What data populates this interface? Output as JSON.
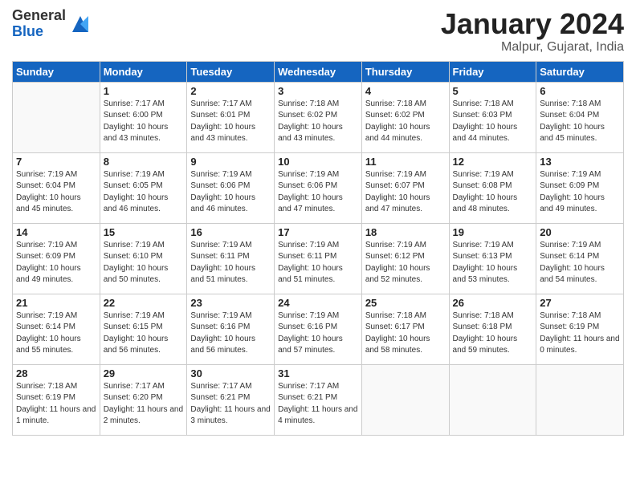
{
  "header": {
    "logo_general": "General",
    "logo_blue": "Blue",
    "title": "January 2024",
    "location": "Malpur, Gujarat, India"
  },
  "weekdays": [
    "Sunday",
    "Monday",
    "Tuesday",
    "Wednesday",
    "Thursday",
    "Friday",
    "Saturday"
  ],
  "weeks": [
    [
      {
        "day": "",
        "sunrise": "",
        "sunset": "",
        "daylight": ""
      },
      {
        "day": "1",
        "sunrise": "Sunrise: 7:17 AM",
        "sunset": "Sunset: 6:00 PM",
        "daylight": "Daylight: 10 hours and 43 minutes."
      },
      {
        "day": "2",
        "sunrise": "Sunrise: 7:17 AM",
        "sunset": "Sunset: 6:01 PM",
        "daylight": "Daylight: 10 hours and 43 minutes."
      },
      {
        "day": "3",
        "sunrise": "Sunrise: 7:18 AM",
        "sunset": "Sunset: 6:02 PM",
        "daylight": "Daylight: 10 hours and 43 minutes."
      },
      {
        "day": "4",
        "sunrise": "Sunrise: 7:18 AM",
        "sunset": "Sunset: 6:02 PM",
        "daylight": "Daylight: 10 hours and 44 minutes."
      },
      {
        "day": "5",
        "sunrise": "Sunrise: 7:18 AM",
        "sunset": "Sunset: 6:03 PM",
        "daylight": "Daylight: 10 hours and 44 minutes."
      },
      {
        "day": "6",
        "sunrise": "Sunrise: 7:18 AM",
        "sunset": "Sunset: 6:04 PM",
        "daylight": "Daylight: 10 hours and 45 minutes."
      }
    ],
    [
      {
        "day": "7",
        "sunrise": "Sunrise: 7:19 AM",
        "sunset": "Sunset: 6:04 PM",
        "daylight": "Daylight: 10 hours and 45 minutes."
      },
      {
        "day": "8",
        "sunrise": "Sunrise: 7:19 AM",
        "sunset": "Sunset: 6:05 PM",
        "daylight": "Daylight: 10 hours and 46 minutes."
      },
      {
        "day": "9",
        "sunrise": "Sunrise: 7:19 AM",
        "sunset": "Sunset: 6:06 PM",
        "daylight": "Daylight: 10 hours and 46 minutes."
      },
      {
        "day": "10",
        "sunrise": "Sunrise: 7:19 AM",
        "sunset": "Sunset: 6:06 PM",
        "daylight": "Daylight: 10 hours and 47 minutes."
      },
      {
        "day": "11",
        "sunrise": "Sunrise: 7:19 AM",
        "sunset": "Sunset: 6:07 PM",
        "daylight": "Daylight: 10 hours and 47 minutes."
      },
      {
        "day": "12",
        "sunrise": "Sunrise: 7:19 AM",
        "sunset": "Sunset: 6:08 PM",
        "daylight": "Daylight: 10 hours and 48 minutes."
      },
      {
        "day": "13",
        "sunrise": "Sunrise: 7:19 AM",
        "sunset": "Sunset: 6:09 PM",
        "daylight": "Daylight: 10 hours and 49 minutes."
      }
    ],
    [
      {
        "day": "14",
        "sunrise": "Sunrise: 7:19 AM",
        "sunset": "Sunset: 6:09 PM",
        "daylight": "Daylight: 10 hours and 49 minutes."
      },
      {
        "day": "15",
        "sunrise": "Sunrise: 7:19 AM",
        "sunset": "Sunset: 6:10 PM",
        "daylight": "Daylight: 10 hours and 50 minutes."
      },
      {
        "day": "16",
        "sunrise": "Sunrise: 7:19 AM",
        "sunset": "Sunset: 6:11 PM",
        "daylight": "Daylight: 10 hours and 51 minutes."
      },
      {
        "day": "17",
        "sunrise": "Sunrise: 7:19 AM",
        "sunset": "Sunset: 6:11 PM",
        "daylight": "Daylight: 10 hours and 51 minutes."
      },
      {
        "day": "18",
        "sunrise": "Sunrise: 7:19 AM",
        "sunset": "Sunset: 6:12 PM",
        "daylight": "Daylight: 10 hours and 52 minutes."
      },
      {
        "day": "19",
        "sunrise": "Sunrise: 7:19 AM",
        "sunset": "Sunset: 6:13 PM",
        "daylight": "Daylight: 10 hours and 53 minutes."
      },
      {
        "day": "20",
        "sunrise": "Sunrise: 7:19 AM",
        "sunset": "Sunset: 6:14 PM",
        "daylight": "Daylight: 10 hours and 54 minutes."
      }
    ],
    [
      {
        "day": "21",
        "sunrise": "Sunrise: 7:19 AM",
        "sunset": "Sunset: 6:14 PM",
        "daylight": "Daylight: 10 hours and 55 minutes."
      },
      {
        "day": "22",
        "sunrise": "Sunrise: 7:19 AM",
        "sunset": "Sunset: 6:15 PM",
        "daylight": "Daylight: 10 hours and 56 minutes."
      },
      {
        "day": "23",
        "sunrise": "Sunrise: 7:19 AM",
        "sunset": "Sunset: 6:16 PM",
        "daylight": "Daylight: 10 hours and 56 minutes."
      },
      {
        "day": "24",
        "sunrise": "Sunrise: 7:19 AM",
        "sunset": "Sunset: 6:16 PM",
        "daylight": "Daylight: 10 hours and 57 minutes."
      },
      {
        "day": "25",
        "sunrise": "Sunrise: 7:18 AM",
        "sunset": "Sunset: 6:17 PM",
        "daylight": "Daylight: 10 hours and 58 minutes."
      },
      {
        "day": "26",
        "sunrise": "Sunrise: 7:18 AM",
        "sunset": "Sunset: 6:18 PM",
        "daylight": "Daylight: 10 hours and 59 minutes."
      },
      {
        "day": "27",
        "sunrise": "Sunrise: 7:18 AM",
        "sunset": "Sunset: 6:19 PM",
        "daylight": "Daylight: 11 hours and 0 minutes."
      }
    ],
    [
      {
        "day": "28",
        "sunrise": "Sunrise: 7:18 AM",
        "sunset": "Sunset: 6:19 PM",
        "daylight": "Daylight: 11 hours and 1 minute."
      },
      {
        "day": "29",
        "sunrise": "Sunrise: 7:17 AM",
        "sunset": "Sunset: 6:20 PM",
        "daylight": "Daylight: 11 hours and 2 minutes."
      },
      {
        "day": "30",
        "sunrise": "Sunrise: 7:17 AM",
        "sunset": "Sunset: 6:21 PM",
        "daylight": "Daylight: 11 hours and 3 minutes."
      },
      {
        "day": "31",
        "sunrise": "Sunrise: 7:17 AM",
        "sunset": "Sunset: 6:21 PM",
        "daylight": "Daylight: 11 hours and 4 minutes."
      },
      {
        "day": "",
        "sunrise": "",
        "sunset": "",
        "daylight": ""
      },
      {
        "day": "",
        "sunrise": "",
        "sunset": "",
        "daylight": ""
      },
      {
        "day": "",
        "sunrise": "",
        "sunset": "",
        "daylight": ""
      }
    ]
  ]
}
